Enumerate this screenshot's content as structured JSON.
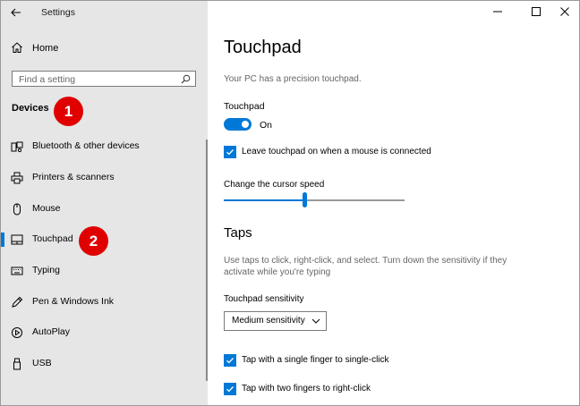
{
  "window": {
    "title": "Settings"
  },
  "sidebar": {
    "home_label": "Home",
    "search_placeholder": "Find a setting",
    "group_title": "Devices",
    "items": [
      {
        "label": "Bluetooth & other devices",
        "icon": "bluetooth-devices-icon"
      },
      {
        "label": "Printers & scanners",
        "icon": "printer-icon"
      },
      {
        "label": "Mouse",
        "icon": "mouse-icon"
      },
      {
        "label": "Touchpad",
        "icon": "touchpad-icon",
        "selected": true
      },
      {
        "label": "Typing",
        "icon": "keyboard-icon"
      },
      {
        "label": "Pen & Windows Ink",
        "icon": "pen-icon"
      },
      {
        "label": "AutoPlay",
        "icon": "autoplay-icon"
      },
      {
        "label": "USB",
        "icon": "usb-icon"
      }
    ]
  },
  "annotations": {
    "badge1": "1",
    "badge2": "2"
  },
  "main": {
    "title": "Touchpad",
    "status": "Your PC has a precision touchpad.",
    "touchpad_label": "Touchpad",
    "toggle_state": "On",
    "leave_on_label": "Leave touchpad on when a mouse is connected",
    "cursor_speed_label": "Change the cursor speed",
    "cursor_speed_value": 0.45,
    "taps_title": "Taps",
    "taps_desc": "Use taps to click, right-click, and select. Turn down the sensitivity if they activate while you're typing",
    "sensitivity_label": "Touchpad sensitivity",
    "sensitivity_value": "Medium sensitivity",
    "tap_single_label": "Tap with a single finger to single-click",
    "tap_two_label": "Tap with two fingers to right-click"
  },
  "colors": {
    "accent": "#0078d7",
    "sidebar_bg": "#e6e6e6",
    "badge": "#e00000"
  }
}
